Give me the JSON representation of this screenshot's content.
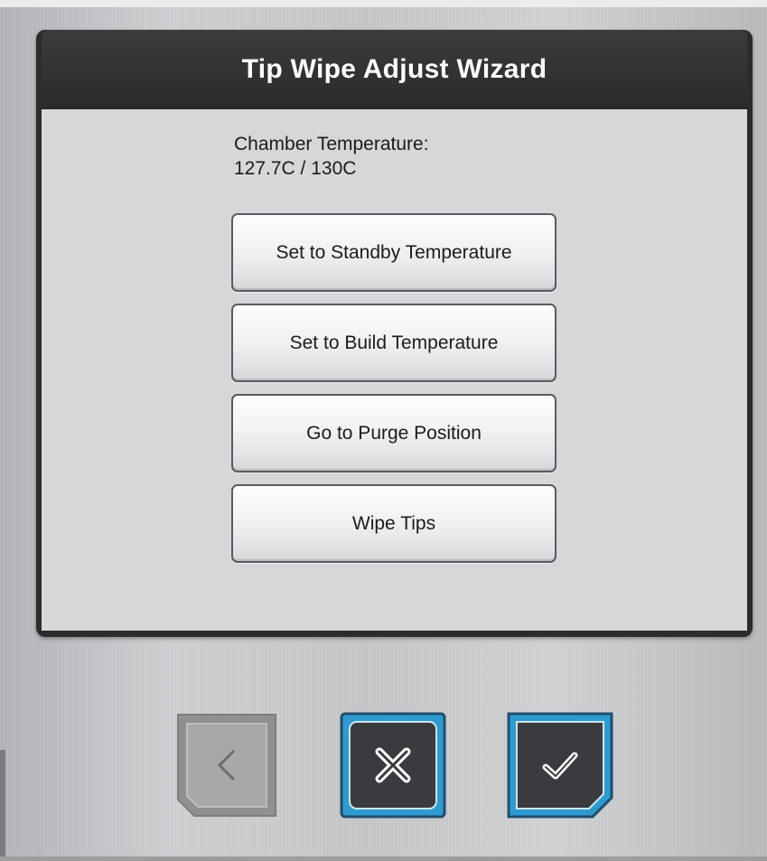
{
  "dialog": {
    "title": "Tip Wipe Adjust Wizard",
    "chamber_label": "Chamber Temperature:",
    "chamber_value": "127.7C / 130C"
  },
  "actions": [
    {
      "label": "Set to Standby Temperature"
    },
    {
      "label": "Set to Build Temperature"
    },
    {
      "label": "Go to Purge Position"
    },
    {
      "label": "Wipe Tips"
    }
  ],
  "nav": {
    "back_icon": "back-arrow-icon",
    "cancel_icon": "x-icon",
    "confirm_icon": "checkmark-icon",
    "back_enabled": false
  },
  "colors": {
    "accent": "#2e9ad0",
    "title_bar": "#2c2c2e",
    "panel": "#d6d7d9",
    "disabled_button": "#a6a7a9"
  }
}
